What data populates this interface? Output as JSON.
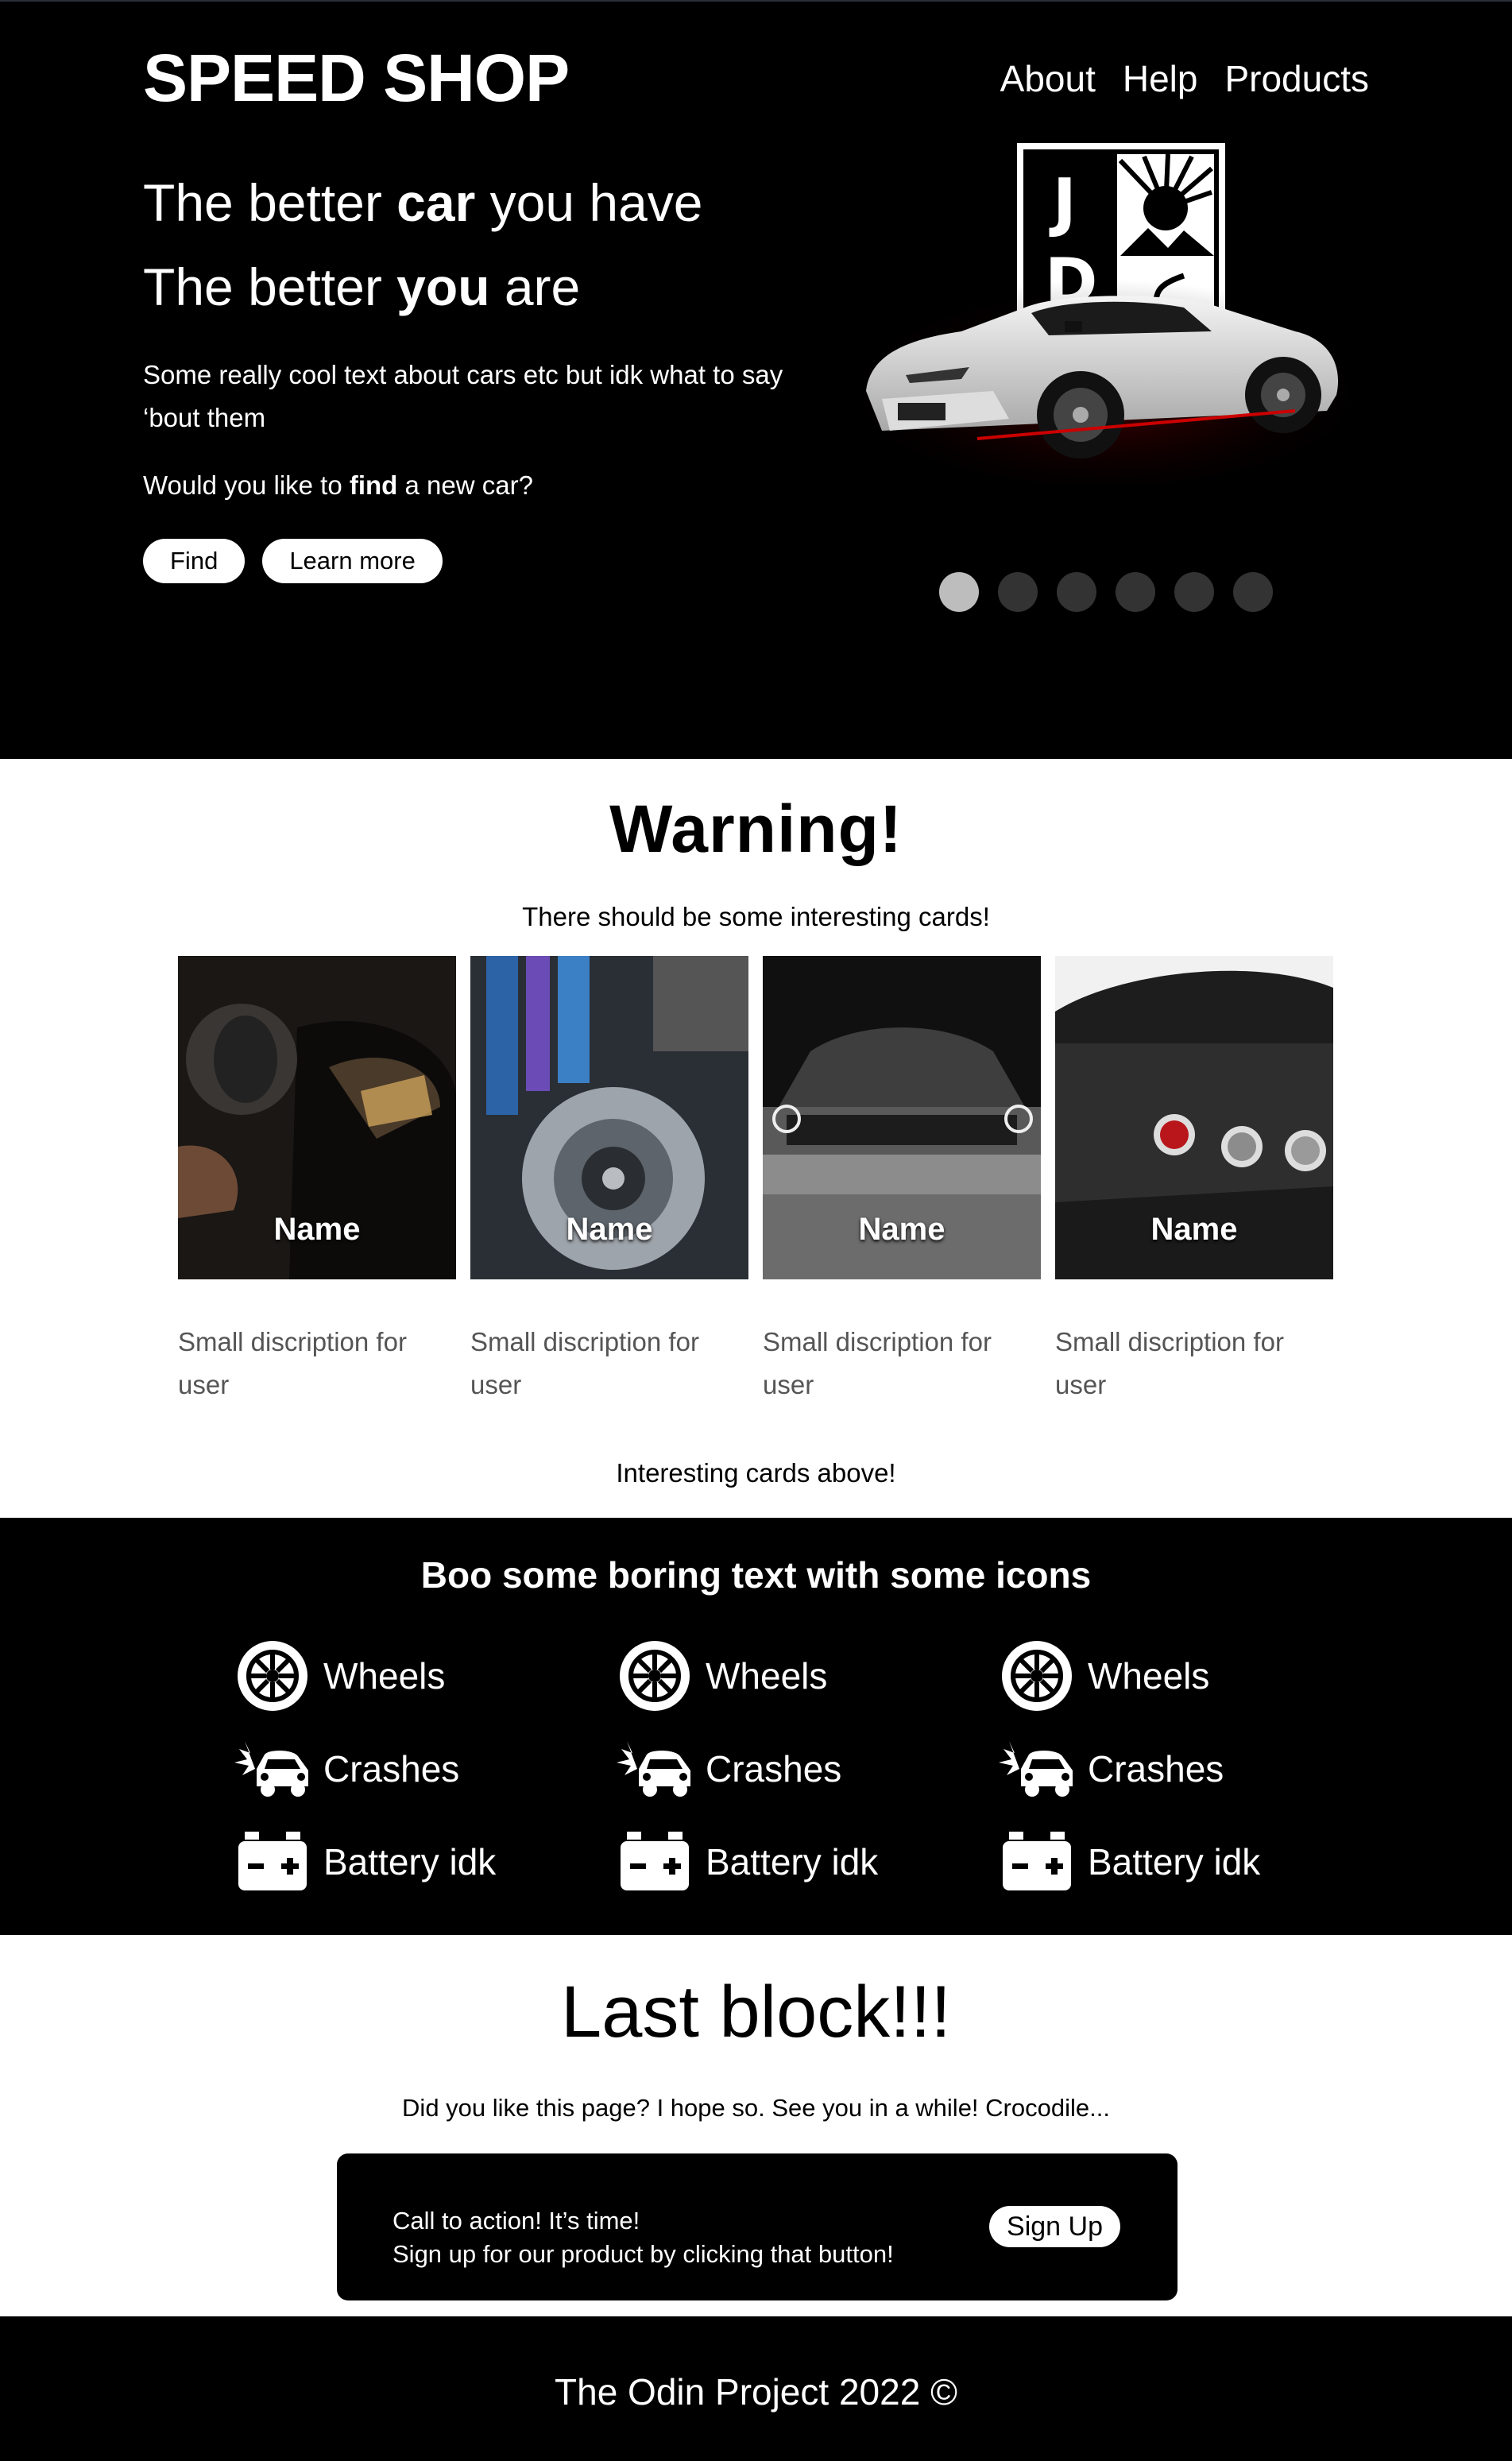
{
  "header": {
    "logo": "SPEED SHOP",
    "nav": [
      "About",
      "Help",
      "Products"
    ]
  },
  "hero": {
    "line1_pre": "The better ",
    "line1_bold": "car",
    "line1_post": " you have",
    "line2_pre": "The better ",
    "line2_bold": "you",
    "line2_post": " are",
    "paragraph": "Some really cool text about cars etc but idk what to say ‘bout them",
    "question_pre": "Would you like to ",
    "question_bold": "find",
    "question_post": " a new car?",
    "button_find": "Find",
    "button_learn": "Learn more",
    "carousel_dots": 6,
    "carousel_active": 1
  },
  "cards_section": {
    "title": "Warning!",
    "subtitle": "There should be some interesting cards!",
    "cards": [
      {
        "name": "Name",
        "description": "Small discription for user"
      },
      {
        "name": "Name",
        "description": "Small discription for user"
      },
      {
        "name": "Name",
        "description": "Small discription for user"
      },
      {
        "name": "Name",
        "description": "Small discription for user"
      }
    ],
    "footer_note": "Interesting cards above!"
  },
  "icons_section": {
    "title": "Boo some boring text with some icons",
    "columns": [
      [
        {
          "icon": "wheel-icon",
          "label": "Wheels"
        },
        {
          "icon": "crash-icon",
          "label": "Crashes"
        },
        {
          "icon": "battery-icon",
          "label": "Battery idk"
        }
      ],
      [
        {
          "icon": "wheel-icon",
          "label": "Wheels"
        },
        {
          "icon": "crash-icon",
          "label": "Crashes"
        },
        {
          "icon": "battery-icon",
          "label": "Battery idk"
        }
      ],
      [
        {
          "icon": "wheel-icon",
          "label": "Wheels"
        },
        {
          "icon": "crash-icon",
          "label": "Crashes"
        },
        {
          "icon": "battery-icon",
          "label": "Battery idk"
        }
      ]
    ]
  },
  "last_section": {
    "title": "Last block!!!",
    "subtitle": "Did you like this page? I hope so. See you in a while! Crocodile...",
    "cta_line1": "Call to action! It’s time!",
    "cta_line2": "Sign up for our product by clicking that button!",
    "cta_button": "Sign Up"
  },
  "footer": {
    "text": "The Odin Project 2022 ©"
  },
  "colors": {
    "dark": "#000000",
    "light": "#ffffff",
    "dot_active": "#bdbdbd",
    "dot_inactive": "#333333",
    "muted_text": "#555555"
  }
}
